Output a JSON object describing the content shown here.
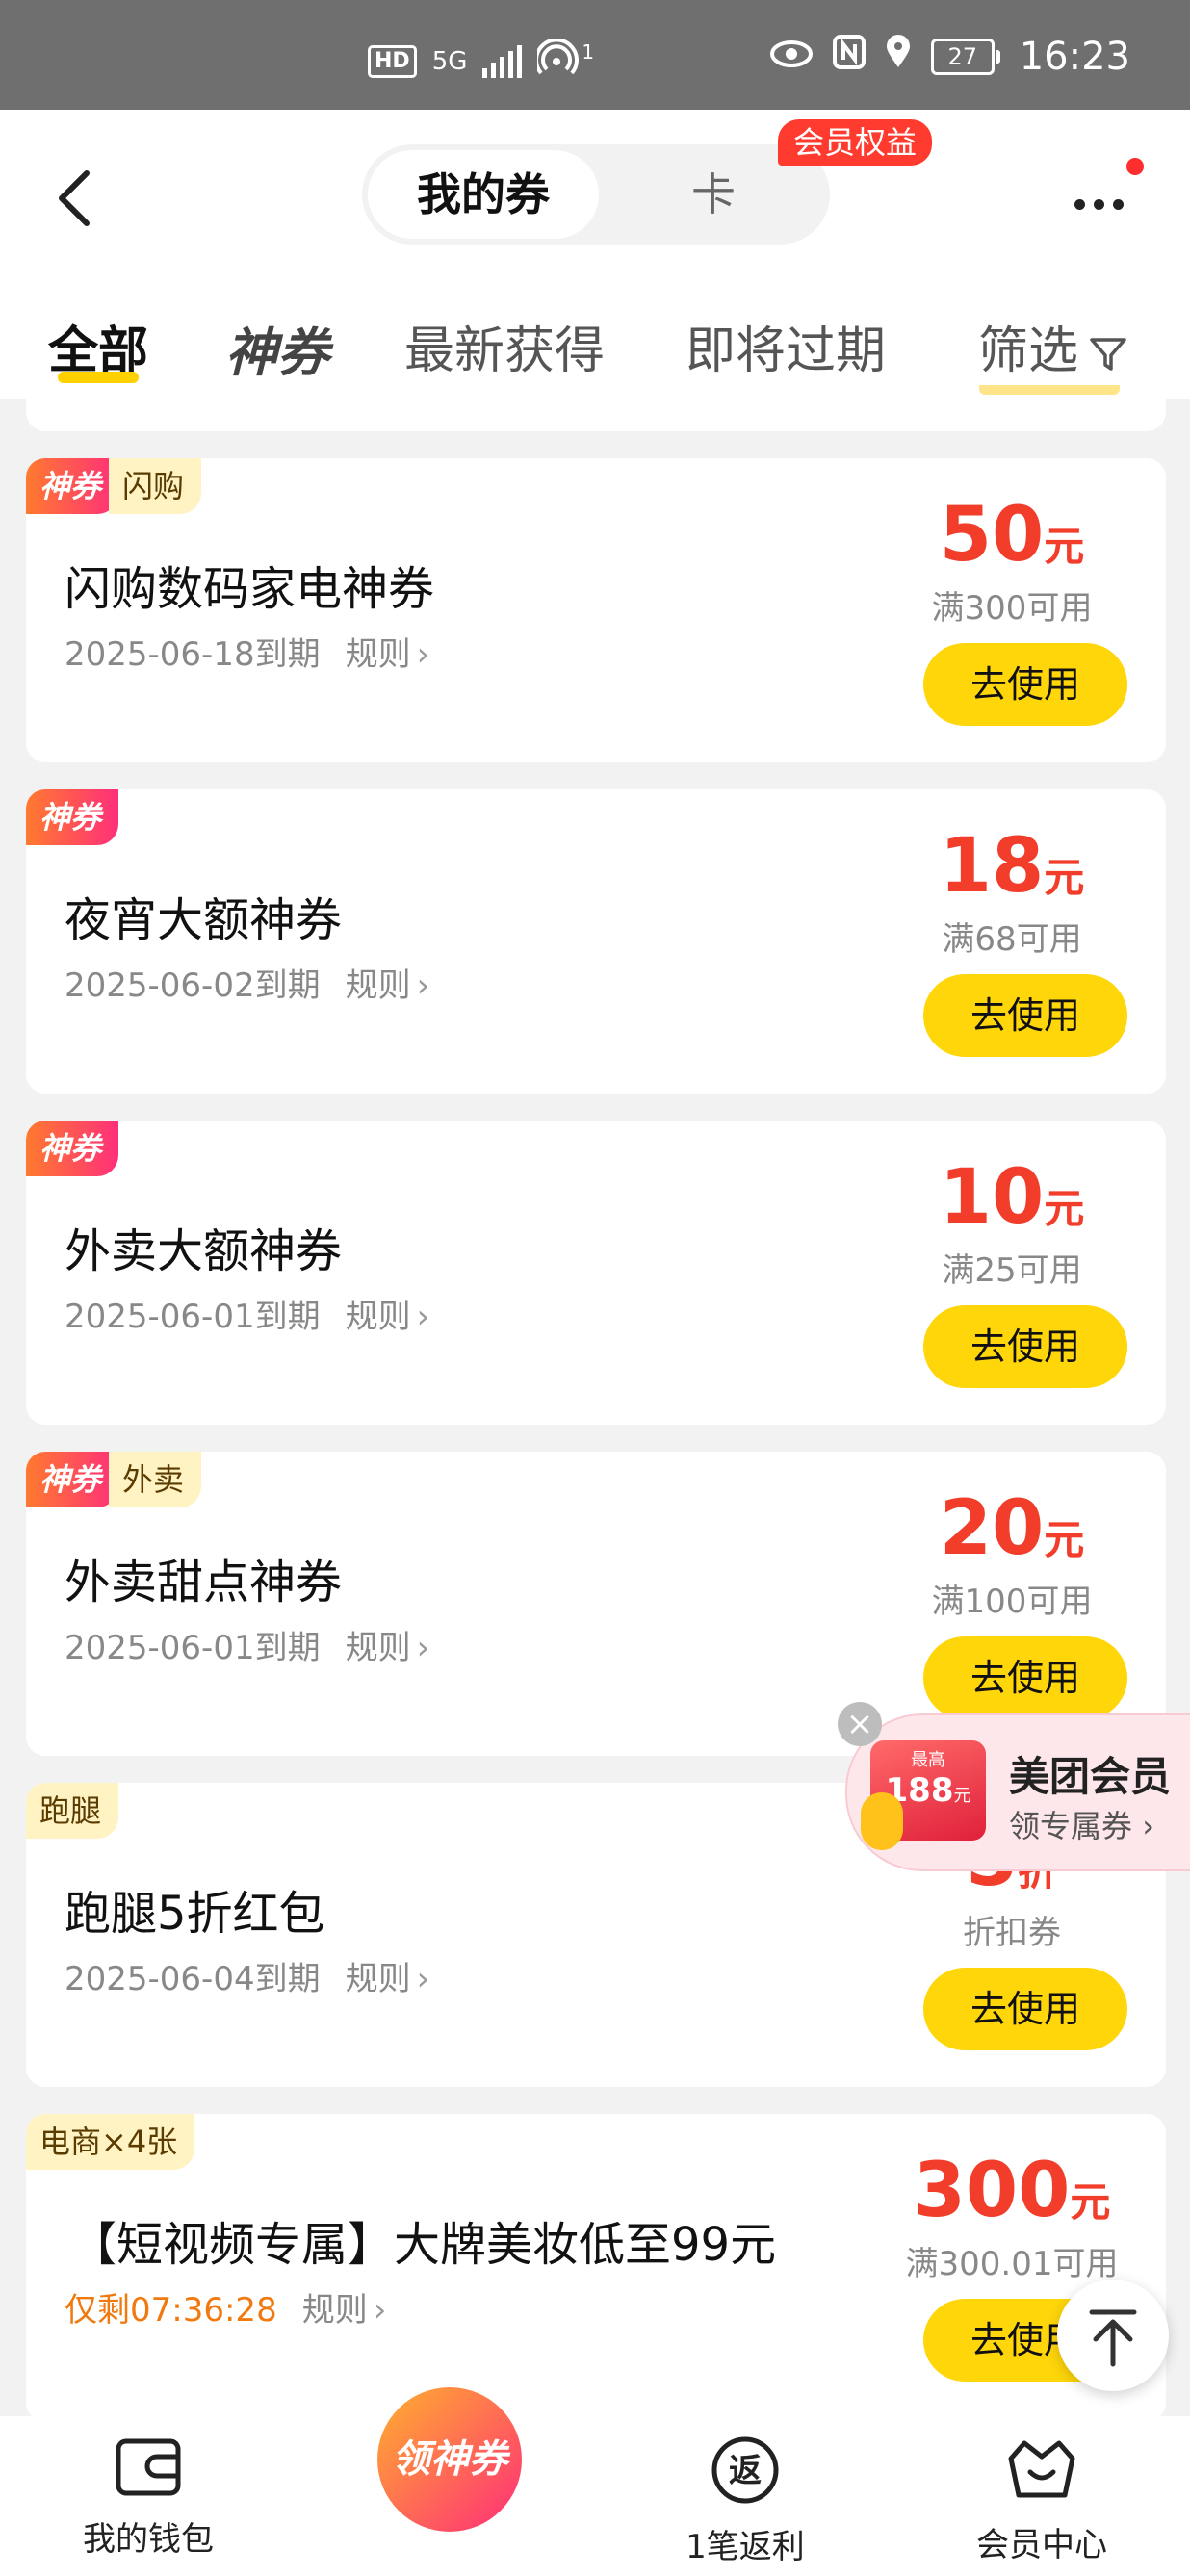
{
  "status_bar": {
    "hd": "HD",
    "network": "5G",
    "hotspot_count": "1",
    "battery": "27",
    "time": "16:23"
  },
  "header": {
    "segment_active": "我的券",
    "segment_other": "卡",
    "member_badge": "会员权益"
  },
  "tabs": [
    {
      "label": "全部"
    },
    {
      "label": "神券"
    },
    {
      "label": "最新获得"
    },
    {
      "label": "即将过期"
    },
    {
      "label": "筛选"
    }
  ],
  "coupons": [
    {
      "shen_tag": "神券",
      "category_tag": "闪购",
      "title": "闪购数码家电神券",
      "expiry": "2025-06-18到期",
      "rule": "规则",
      "amount": "50",
      "unit": "元",
      "condition": "满300可用",
      "button": "去使用"
    },
    {
      "shen_tag": "神券",
      "title": "夜宵大额神券",
      "expiry": "2025-06-02到期",
      "rule": "规则",
      "amount": "18",
      "unit": "元",
      "condition": "满68可用",
      "button": "去使用"
    },
    {
      "shen_tag": "神券",
      "title": "外卖大额神券",
      "expiry": "2025-06-01到期",
      "rule": "规则",
      "amount": "10",
      "unit": "元",
      "condition": "满25可用",
      "button": "去使用"
    },
    {
      "shen_tag": "神券",
      "category_tag": "外卖",
      "title": "外卖甜点神券",
      "expiry": "2025-06-01到期",
      "rule": "规则",
      "amount": "20",
      "unit": "元",
      "condition": "满100可用",
      "button": "去使用"
    },
    {
      "category_tag": "跑腿",
      "title": "跑腿5折红包",
      "expiry": "2025-06-04到期",
      "rule": "规则",
      "amount": "5",
      "unit": "折",
      "condition": "折扣券",
      "button": "去使用"
    },
    {
      "category_tag": "电商×4张",
      "title": "【短视频专属】大牌美妆低至99元",
      "countdown": "仅剩07:36:28",
      "rule": "规则",
      "amount": "300",
      "unit": "元",
      "condition": "满300.01可用",
      "button": "去使用"
    }
  ],
  "member_popup": {
    "coupon_top": "最高",
    "coupon_amount": "188",
    "coupon_unit": "元",
    "title": "美团会员",
    "subtitle": "领专属券"
  },
  "bottom_nav": {
    "wallet": "我的钱包",
    "center": "领神券",
    "rebate": "1笔返利",
    "member": "会员中心",
    "rebate_icon_char": "返"
  },
  "colors": {
    "accent_yellow": "#ffd60a",
    "price_red": "#f23d2b",
    "badge_red": "#ff3b2f",
    "countdown_orange": "#f07a10"
  }
}
